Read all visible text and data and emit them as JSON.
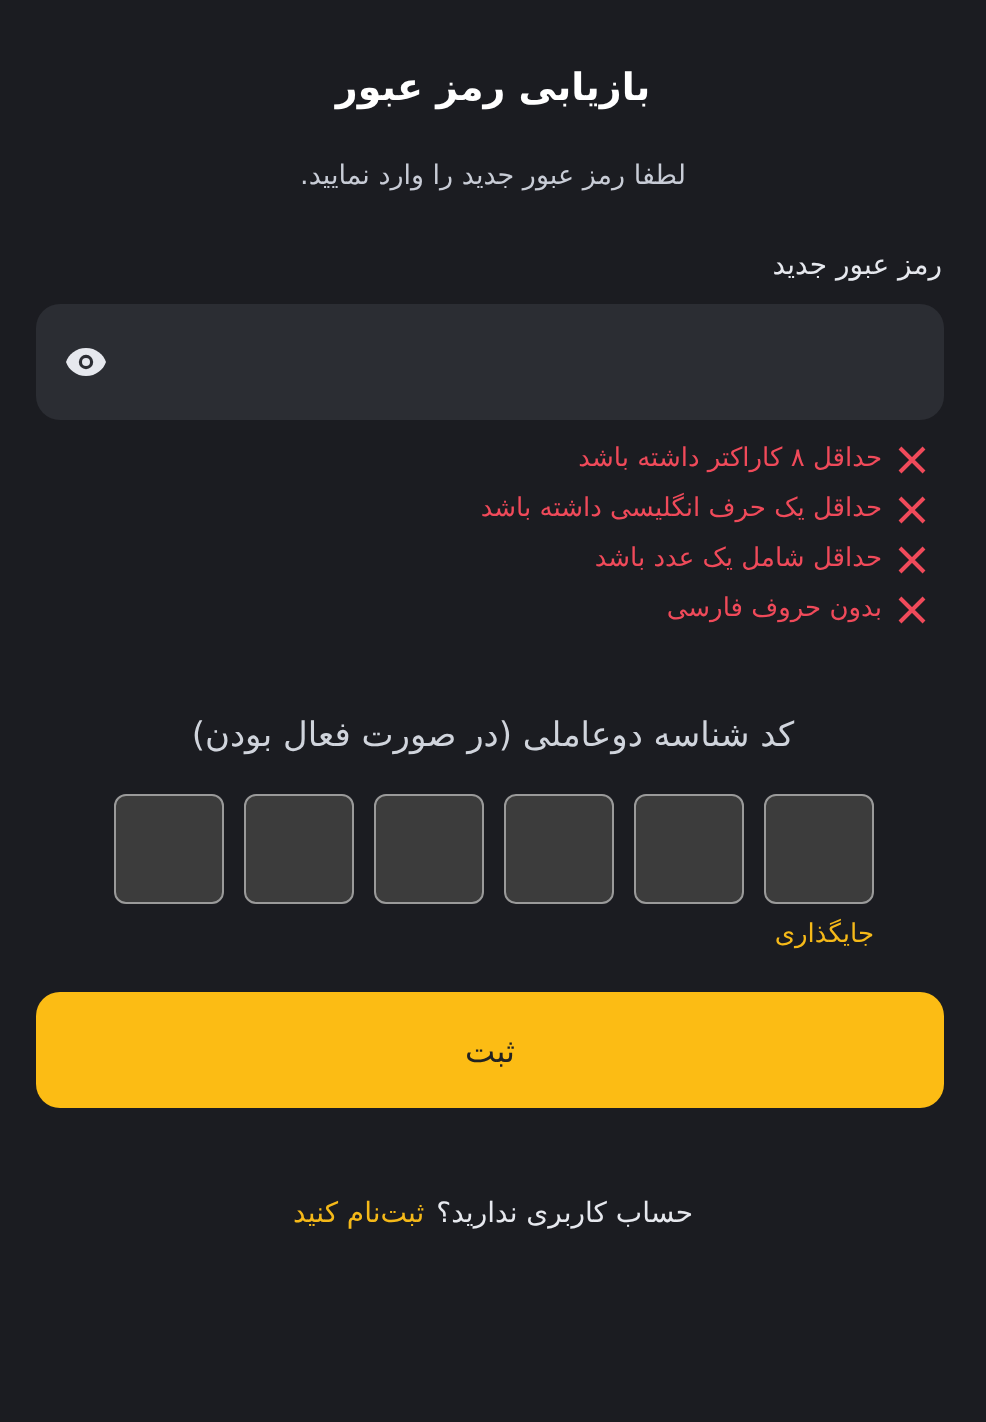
{
  "title": "بازیابی رمز عبور",
  "subtitle": "لطفا رمز عبور جدید را وارد نمایید.",
  "password": {
    "label": "رمز عبور جدید",
    "revealed": false
  },
  "rules": [
    {
      "text": "حداقل ۸ کاراکتر داشته باشد",
      "met": false
    },
    {
      "text": "حداقل یک حرف انگلیسی داشته باشد",
      "met": false
    },
    {
      "text": "حداقل شامل یک عدد باشد",
      "met": false
    },
    {
      "text": "بدون حروف فارسی",
      "met": false
    }
  ],
  "otp": {
    "label": "کد شناسه دوعاملی (در صورت فعال بودن)",
    "boxes": [
      {
        "filled": false
      },
      {
        "filled": false
      },
      {
        "filled": false
      },
      {
        "filled": false
      },
      {
        "filled": false
      },
      {
        "filled": false
      }
    ],
    "paste": "جایگذاری"
  },
  "submit": "ثبت",
  "footer": {
    "question": "حساب کاربری ندارید؟",
    "link": "ثبت‌نام کنید"
  }
}
